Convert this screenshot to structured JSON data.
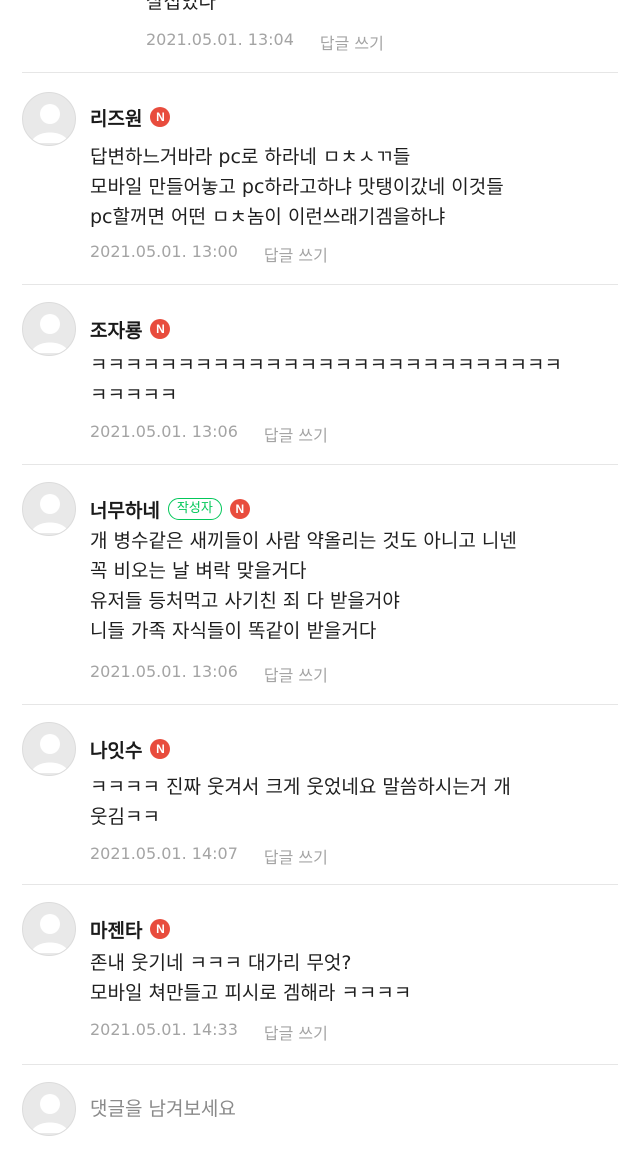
{
  "top_reply": {
    "text": "살접었다",
    "date": "2021.05.01. 13:04",
    "reply_label": "답글 쓰기"
  },
  "comments": [
    {
      "author": "리즈원",
      "badge": "N",
      "lines": [
        "답변하느거바라 pc로 하라네 ㅁㅊㅅㄲ들",
        "모바일 만들어놓고 pc하라고하냐 맛탱이갔네 이것들",
        "pc할꺼면 어떤 ㅁㅊ놈이 이런쓰래기겜을하냐"
      ],
      "date": "2021.05.01. 13:00",
      "reply_label": "답글 쓰기"
    },
    {
      "author": "조자룡",
      "badge": "N",
      "lines": [
        "ㅋㅋㅋㅋㅋㅋㅋㅋㅋㅋㅋㅋㅋㅋㅋㅋㅋㅋㅋㅋㅋㅋㅋㅋㅋㅋㅋ",
        "ㅋㅋㅋㅋㅋ"
      ],
      "date": "2021.05.01. 13:06",
      "reply_label": "답글 쓰기"
    },
    {
      "author": "너무하네",
      "writer_badge": "작성자",
      "badge": "N",
      "lines": [
        "개 병수같은 새끼들이 사람 약올리는 것도 아니고 니넨",
        "꼭 비오는 날 벼락 맞을거다",
        "유저들 등처먹고 사기친 죄 다 받을거야",
        "니들 가족 자식들이 똑같이 받을거다"
      ],
      "date": "2021.05.01. 13:06",
      "reply_label": "답글 쓰기"
    },
    {
      "author": "나잇수",
      "badge": "N",
      "lines": [
        "ㅋㅋㅋㅋ 진짜 웃겨서 크게 웃었네요 말씀하시는거 개",
        "웃김ㅋㅋ"
      ],
      "date": "2021.05.01. 14:07",
      "reply_label": "답글 쓰기"
    },
    {
      "author": "마젠타",
      "badge": "N",
      "lines": [
        "존내 웃기네 ㅋㅋㅋ 대가리 무엇?",
        "모바일 쳐만들고 피시로 겜해라 ㅋㅋㅋㅋ"
      ],
      "date": "2021.05.01. 14:33",
      "reply_label": "답글 쓰기"
    }
  ],
  "comment_input": {
    "placeholder": "댓글을 남겨보세요"
  }
}
